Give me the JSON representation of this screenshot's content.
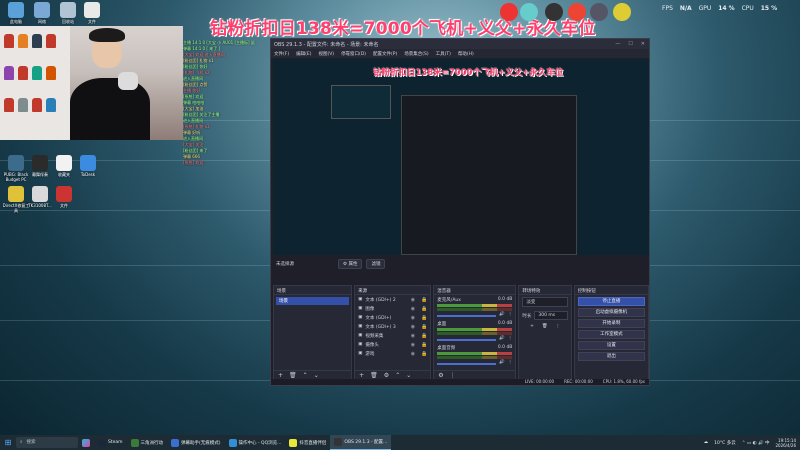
{
  "banner": {
    "title": "钻粉折扣日138米=7000个飞机+义父+永久车位"
  },
  "stats": {
    "fps_label": "FPS",
    "fps_value": "N/A",
    "gpu_label": "GPU",
    "gpu_value": "14 %",
    "cpu_label": "CPU",
    "cpu_value": "15 %"
  },
  "desktop": {
    "icons_top": [
      "此电脑",
      "网络",
      "回收站",
      "文件"
    ],
    "icons_left": [
      "PUBG: Black Budget PC",
      "幕舞伴奏",
      "收藏夹",
      "ToDesk",
      "DirectX修复工具",
      "TK31008T...",
      "文件"
    ]
  },
  "chat": {
    "lines": [
      "主播 14:1 0 [大宝 小 AU01 [主播标] 鲨",
      "弹幕 14:1 0 [ 来了 ]",
      "[大宝]  欢迎 进入直播间",
      "[粉丝团] 礼物 x1",
      "[粉丝团] 你好",
      "[礼物] 飞机 x2",
      "进入直播间",
      "[粉丝团] 点赞",
      "主播 你好",
      "[系统] 欢迎",
      "弹幕 哈哈哈",
      "[大宝] 加油",
      "[粉丝团] 关注了主播",
      "进入直播间",
      "[系统] 礼物 x3",
      "弹幕 好听",
      "进入直播间",
      "[大宝] 关注",
      "[粉丝团] 来了",
      "弹幕 666",
      "[系统] 欢迎"
    ]
  },
  "obs": {
    "title": "OBS 29.1.3 - 配置文件: 未命名 - 场景: 未命名",
    "menu": [
      "文件(F)",
      "编辑(E)",
      "视图(V)",
      "停靠窗口(D)",
      "配置文件(P)",
      "场景集合(S)",
      "工具(T)",
      "帮助(H)"
    ],
    "toolbar": {
      "no_source": "未选择源",
      "properties": "属性",
      "filters": "滤镜"
    },
    "scenes": {
      "header": "场景",
      "items": [
        "场景"
      ]
    },
    "sources": {
      "header": "来源",
      "items": [
        "文本 (GDI+) 2",
        "图像",
        "文本 (GDI+)",
        "文本 (GDI+) 3",
        "视频采集",
        "摄像头",
        "游戏"
      ]
    },
    "mixer": {
      "header": "混音器",
      "channels": [
        {
          "name": "麦克风/Aux",
          "db": "0.0 dB"
        },
        {
          "name": "桌面",
          "db": "0.0 dB"
        },
        {
          "name": "桌面音频",
          "db": "0.0 dB"
        }
      ]
    },
    "transitions": {
      "header": "转场特效",
      "effect": "淡变",
      "duration_label": "时长",
      "duration_value": "300 ms"
    },
    "controls": {
      "header": "控制按钮",
      "buttons": [
        "停止直播",
        "启动虚拟摄像机",
        "开始录制",
        "工作室模式",
        "设置",
        "退出"
      ]
    },
    "status": {
      "live": "LIVE: 00:00:00",
      "rec": "REC: 00:00:00",
      "cpu": "CPU: 1.8%, 60.00 fps"
    }
  },
  "taskbar": {
    "search": "搜索",
    "apps": [
      "Steam",
      "三角洲行动",
      "弹幕助手(无痕模式)",
      "操作中心 - QQ浏览...",
      "抖音直播伴侣",
      "OBS 29.1.3 - 配置..."
    ],
    "weather": "10°C 多云",
    "time": "19:15:14",
    "date": "2026/4/26"
  },
  "colors": {
    "banner": "#ff3f6e",
    "obs_bg": "#1e1f29",
    "accent": "#3450a8"
  }
}
